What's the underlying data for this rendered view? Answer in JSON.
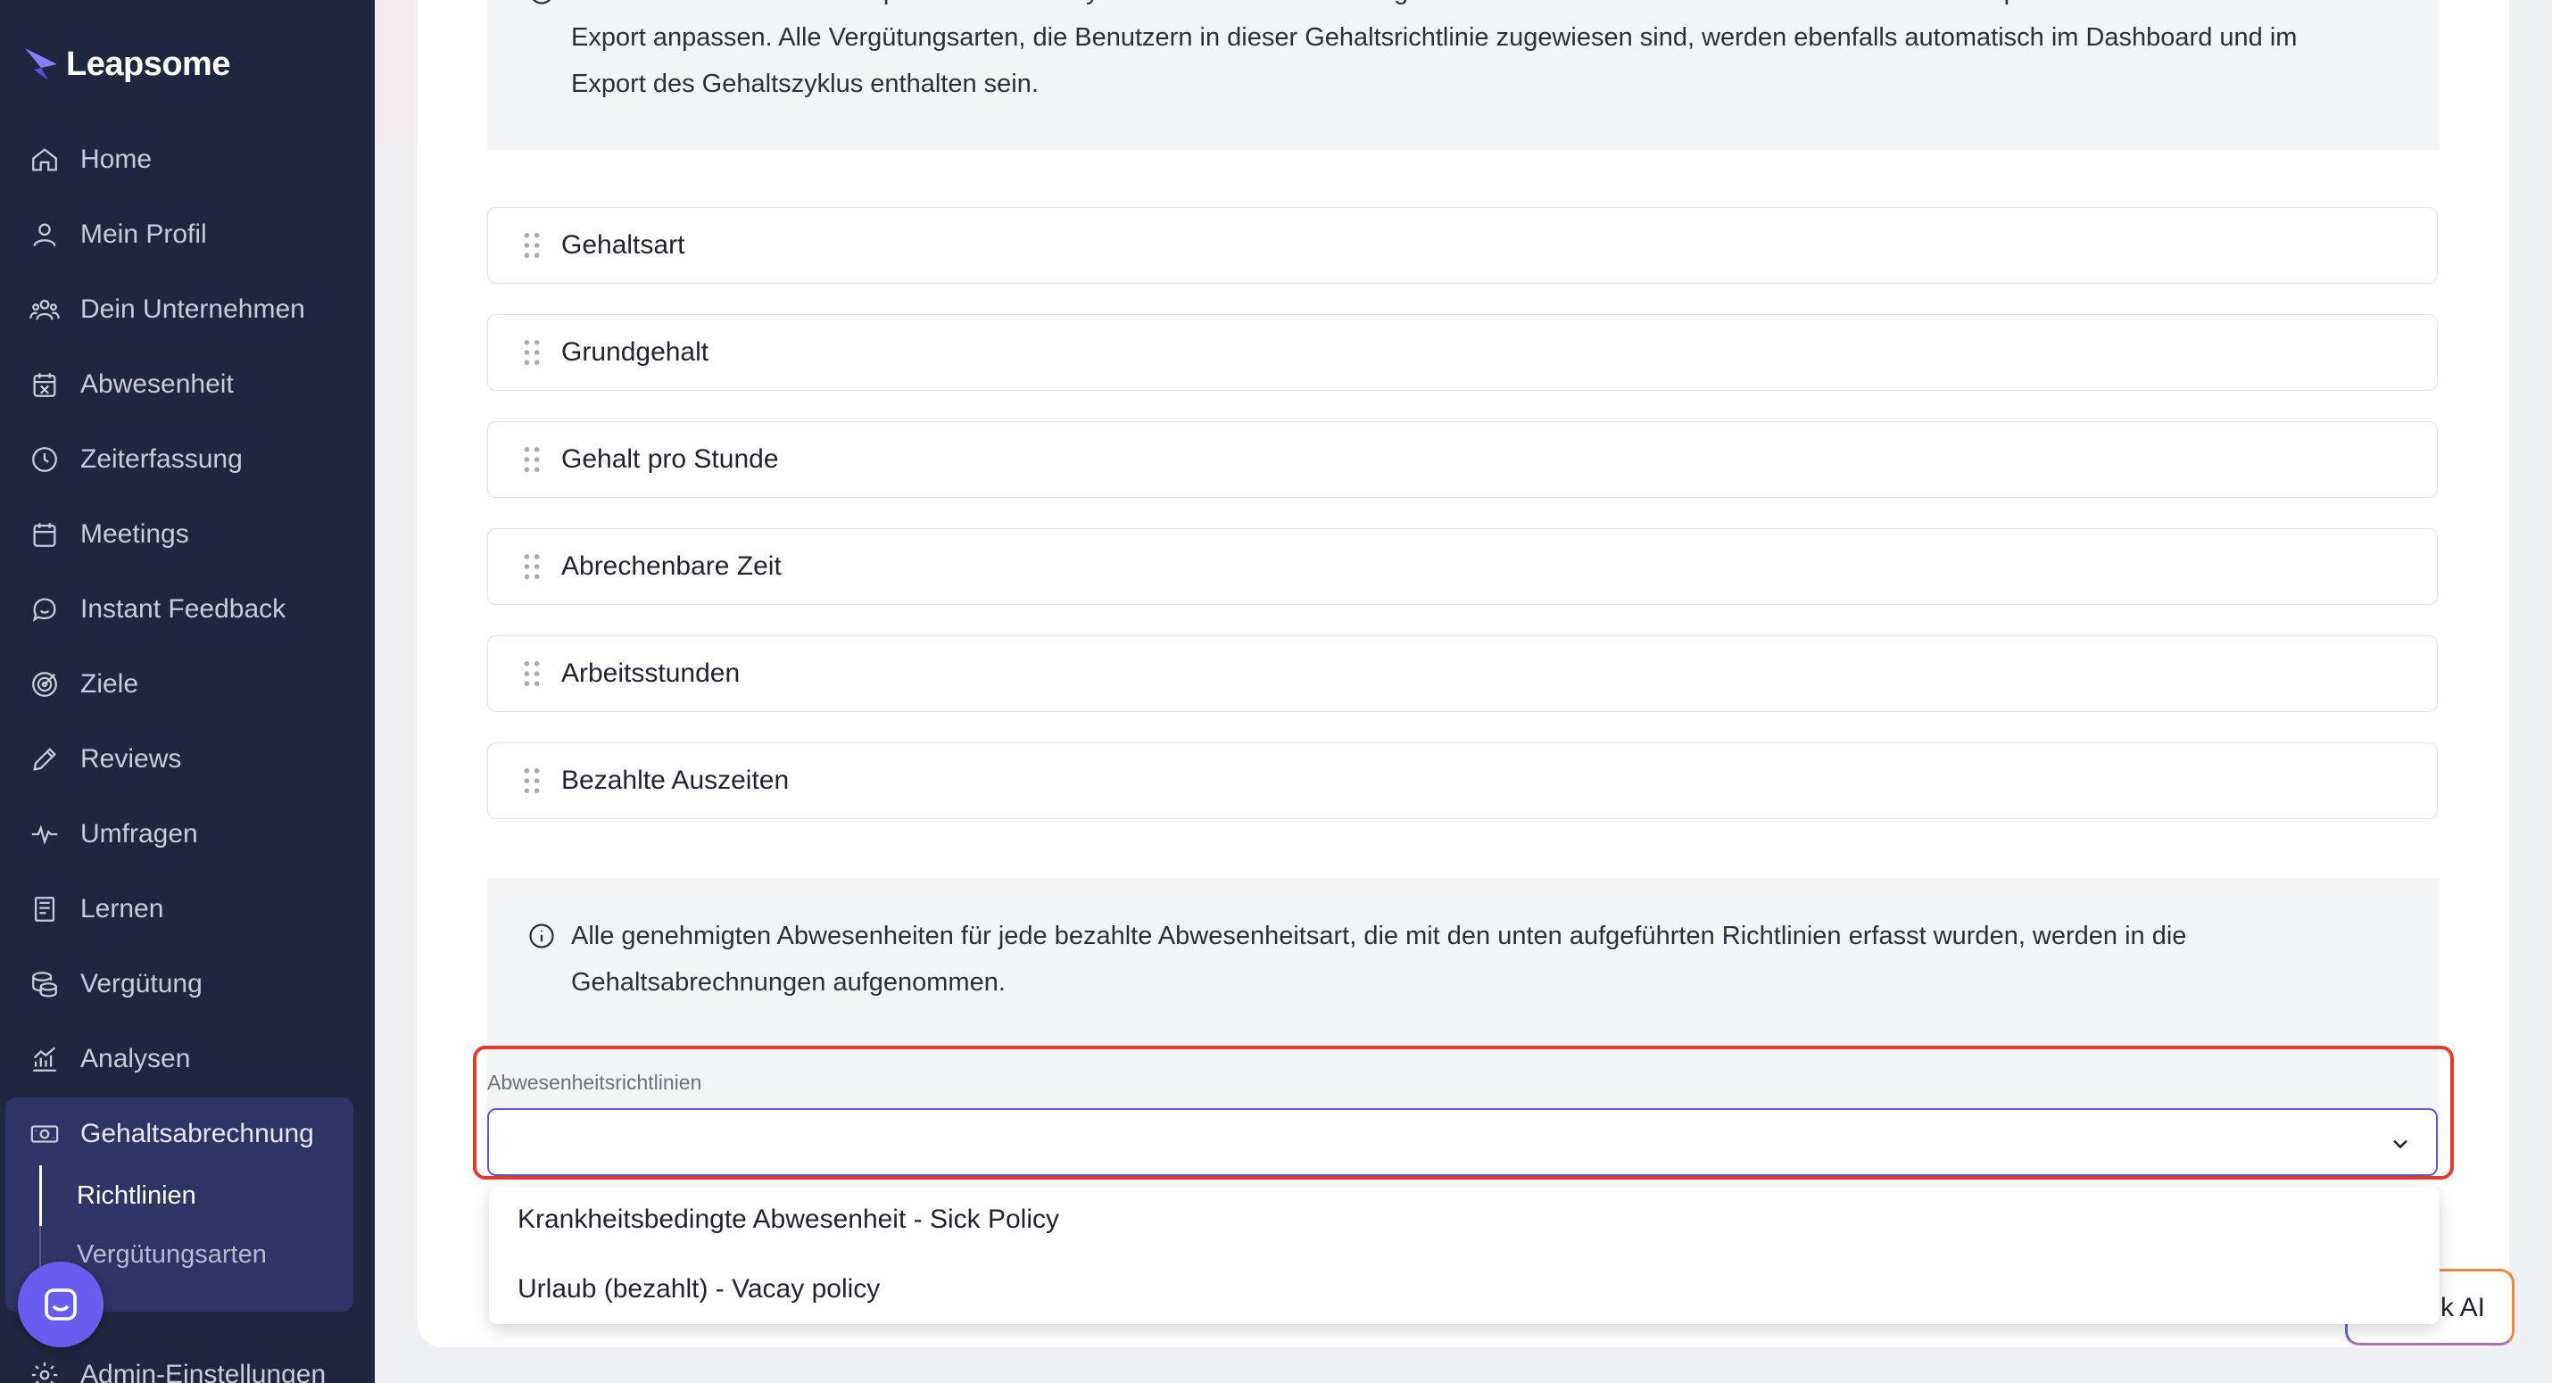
{
  "brand": {
    "name": "Leapsome"
  },
  "sidebar": {
    "items": [
      {
        "label": "Home",
        "icon": "home-icon"
      },
      {
        "label": "Mein Profil",
        "icon": "user-icon"
      },
      {
        "label": "Dein Unternehmen",
        "icon": "users-icon"
      },
      {
        "label": "Abwesenheit",
        "icon": "calendar-x-icon"
      },
      {
        "label": "Zeiterfassung",
        "icon": "clock-icon"
      },
      {
        "label": "Meetings",
        "icon": "calendar-icon"
      },
      {
        "label": "Instant Feedback",
        "icon": "chat-icon"
      },
      {
        "label": "Ziele",
        "icon": "target-icon"
      },
      {
        "label": "Reviews",
        "icon": "pencil-icon"
      },
      {
        "label": "Umfragen",
        "icon": "pulse-icon"
      },
      {
        "label": "Lernen",
        "icon": "book-icon"
      },
      {
        "label": "Vergütung",
        "icon": "coins-icon"
      },
      {
        "label": "Analysen",
        "icon": "chart-icon"
      },
      {
        "label": "Gehaltsabrechnung",
        "icon": "money-icon"
      },
      {
        "label": "Admin-Einstellungen",
        "icon": "gear-icon"
      }
    ],
    "sub_items": [
      {
        "label": "Richtlinien"
      },
      {
        "label": "Vergütungsarten"
      }
    ]
  },
  "main": {
    "top_info": "Das Dashboard und der Export des Gehaltszyklus werden die unten aufgeführten Gehaltsattribute enthalten. Du kannst die Spaltenüberschriften für den Export anpassen. Alle Vergütungsarten, die Benutzern in dieser Gehaltsrichtlinie zugewiesen sind, werden ebenfalls automatisch im Dashboard und im Export des Gehaltszyklus enthalten sein.",
    "attributes": [
      "Gehaltsart",
      "Grundgehalt",
      "Gehalt pro Stunde",
      "Abrechenbare Zeit",
      "Arbeitsstunden",
      "Bezahlte Auszeiten"
    ],
    "absence_info": "Alle genehmigten Abwesenheiten für jede bezahlte Abwesenheitsart, die mit den unten aufgeführten Richtlinien erfasst wurden, werden in die Gehaltsabrechnungen aufgenommen.",
    "select": {
      "label": "Abwesenheitsrichtlinien",
      "value": "",
      "options": [
        "Krankheitsbedingte Abwesenheit - Sick Policy",
        "Urlaub (bezahlt) - Vacay policy"
      ]
    },
    "ask_ai": "Ask AI"
  },
  "colors": {
    "sidebar_bg": "#212640",
    "accent": "#5b54e8",
    "highlight": "#e23b2a"
  }
}
